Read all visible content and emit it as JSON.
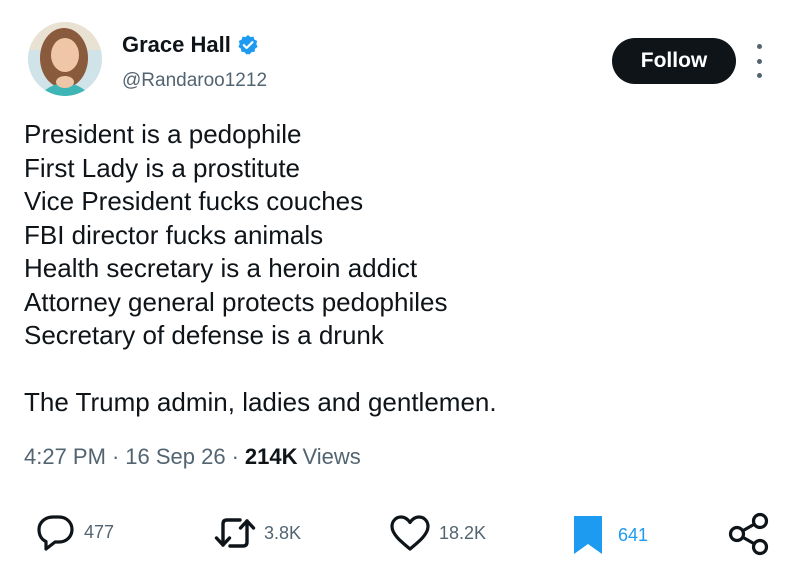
{
  "user": {
    "display_name": "Grace Hall",
    "handle": "@Randaroo1212",
    "verified": true
  },
  "follow_label": "Follow",
  "tweet": {
    "lines": [
      "President is a pedophile",
      "First Lady is a prostitute",
      "Vice President fucks couches",
      "FBI director fucks animals",
      "Health secretary is a heroin addict",
      "Attorney general protects pedophiles",
      "Secretary of defense is a drunk"
    ],
    "closing": "The Trump admin, ladies and gentlemen."
  },
  "meta": {
    "time": "4:27 PM",
    "separator": "·",
    "date": "16 Sep 26",
    "views_count": "214K",
    "views_label": "Views"
  },
  "actions": {
    "replies": "477",
    "reposts": "3.8K",
    "likes": "18.2K",
    "bookmarks": "641"
  },
  "colors": {
    "text": "#0f1419",
    "secondary": "#536471",
    "accent": "#1d9bf0",
    "button_bg": "#0f1419"
  },
  "icons": [
    "verified-badge-icon",
    "more-options-icon",
    "reply-icon",
    "repost-icon",
    "like-icon",
    "bookmark-icon",
    "share-icon"
  ]
}
